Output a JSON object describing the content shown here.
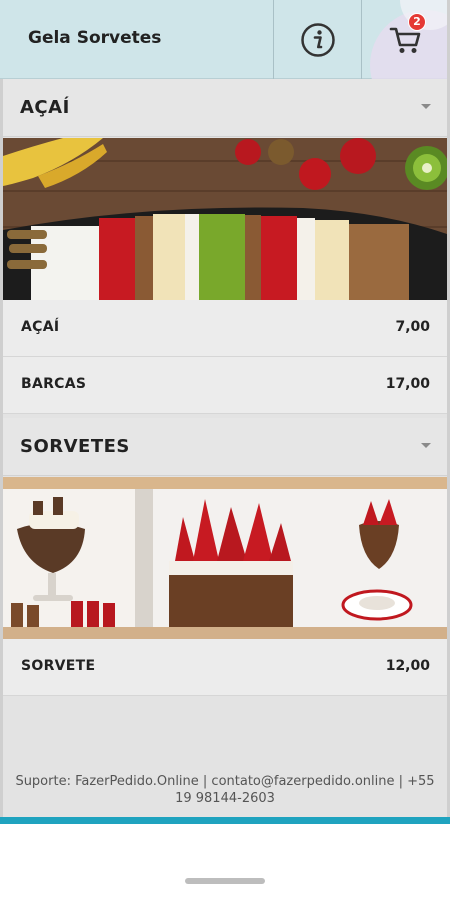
{
  "header": {
    "title": "Gela Sorvetes",
    "info_icon": "info-icon",
    "cart_icon": "cart-icon",
    "cart_count": "2"
  },
  "sections": [
    {
      "name": "AÇAÍ",
      "banner": "acai-bowl-image",
      "items": [
        {
          "label": "AÇAÍ",
          "price": "7,00"
        },
        {
          "label": "BARCAS",
          "price": "17,00"
        }
      ]
    },
    {
      "name": "SORVETES",
      "banner": "ice-cream-desserts-image",
      "items": [
        {
          "label": "SORVETE",
          "price": "12,00"
        }
      ]
    }
  ],
  "footer": {
    "text": "Suporte: FazerPedido.Online | contato@fazerpedido.online | +55 19 98144-2603"
  },
  "colors": {
    "header_bg": "#cfe5e9",
    "badge": "#e53935",
    "bottom_bar": "#1fa3bf",
    "list_bg": "#ececec"
  }
}
